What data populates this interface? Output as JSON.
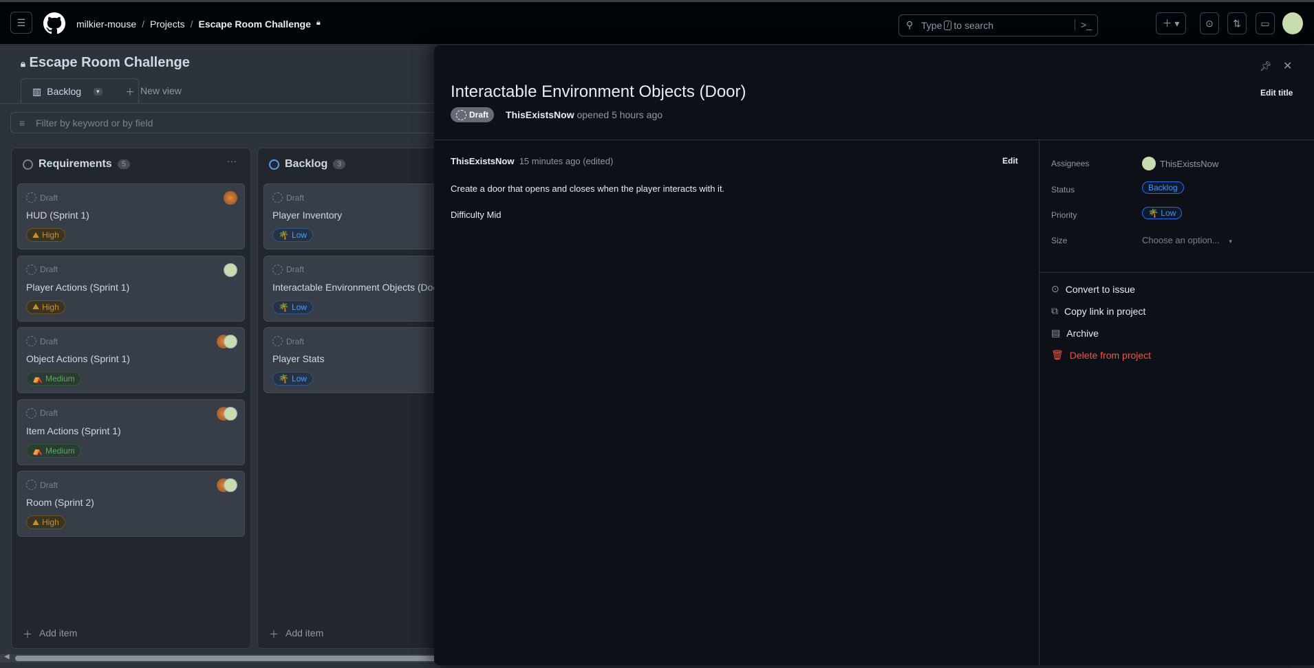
{
  "breadcrumb": {
    "owner": "milkier-mouse",
    "projects": "Projects",
    "project": "Escape Room Challenge"
  },
  "search": {
    "prefix": "Type",
    "key": "/",
    "suffix": "to search"
  },
  "board": {
    "title": "Escape Room Challenge",
    "view_tab": "Backlog",
    "new_view": "New view",
    "filter_placeholder": "Filter by keyword or by field",
    "columns": [
      {
        "name": "Requirements",
        "count": "5",
        "add": "Add item",
        "cards": [
          {
            "status": "Draft",
            "title": "HUD (Sprint 1)",
            "priority": "High",
            "avatars": [
              "orange"
            ]
          },
          {
            "status": "Draft",
            "title": "Player Actions (Sprint 1)",
            "priority": "High",
            "avatars": [
              "green"
            ]
          },
          {
            "status": "Draft",
            "title": "Object Actions (Sprint 1)",
            "priority": "Medium",
            "avatars": [
              "orange",
              "green"
            ]
          },
          {
            "status": "Draft",
            "title": "Item Actions (Sprint 1)",
            "priority": "Medium",
            "avatars": [
              "orange",
              "green"
            ]
          },
          {
            "status": "Draft",
            "title": "Room (Sprint 2)",
            "priority": "High",
            "avatars": [
              "orange",
              "green"
            ]
          }
        ]
      },
      {
        "name": "Backlog",
        "count": "3",
        "add": "Add item",
        "cards": [
          {
            "status": "Draft",
            "title": "Player Inventory",
            "priority": "Low"
          },
          {
            "status": "Draft",
            "title": "Interactable Environment Objects (Door)",
            "priority": "Low"
          },
          {
            "status": "Draft",
            "title": "Player Stats",
            "priority": "Low"
          }
        ]
      }
    ]
  },
  "panel": {
    "title": "Interactable Environment Objects (Door)",
    "edit_title": "Edit title",
    "badge": "Draft",
    "author": "ThisExistsNow",
    "opened": "opened 5 hours ago",
    "comment": {
      "author": "ThisExistsNow",
      "time": "15 minutes ago (edited)",
      "edit": "Edit",
      "lines": [
        "Create a door that opens and closes when the player interacts with it.",
        "Difficulty Mid"
      ]
    },
    "fields": {
      "assignees_label": "Assignees",
      "assignee": "ThisExistsNow",
      "status_label": "Status",
      "status": "Backlog",
      "priority_label": "Priority",
      "priority": "Low",
      "size_label": "Size",
      "size": "Choose an option..."
    },
    "actions": [
      "Convert to issue",
      "Copy link in project",
      "Archive",
      "Delete from project"
    ]
  },
  "colors": {
    "accent": "#4493f8",
    "danger": "#f85149",
    "high": "#c69026",
    "medium": "#57ab5a",
    "low": "#539bf5"
  }
}
